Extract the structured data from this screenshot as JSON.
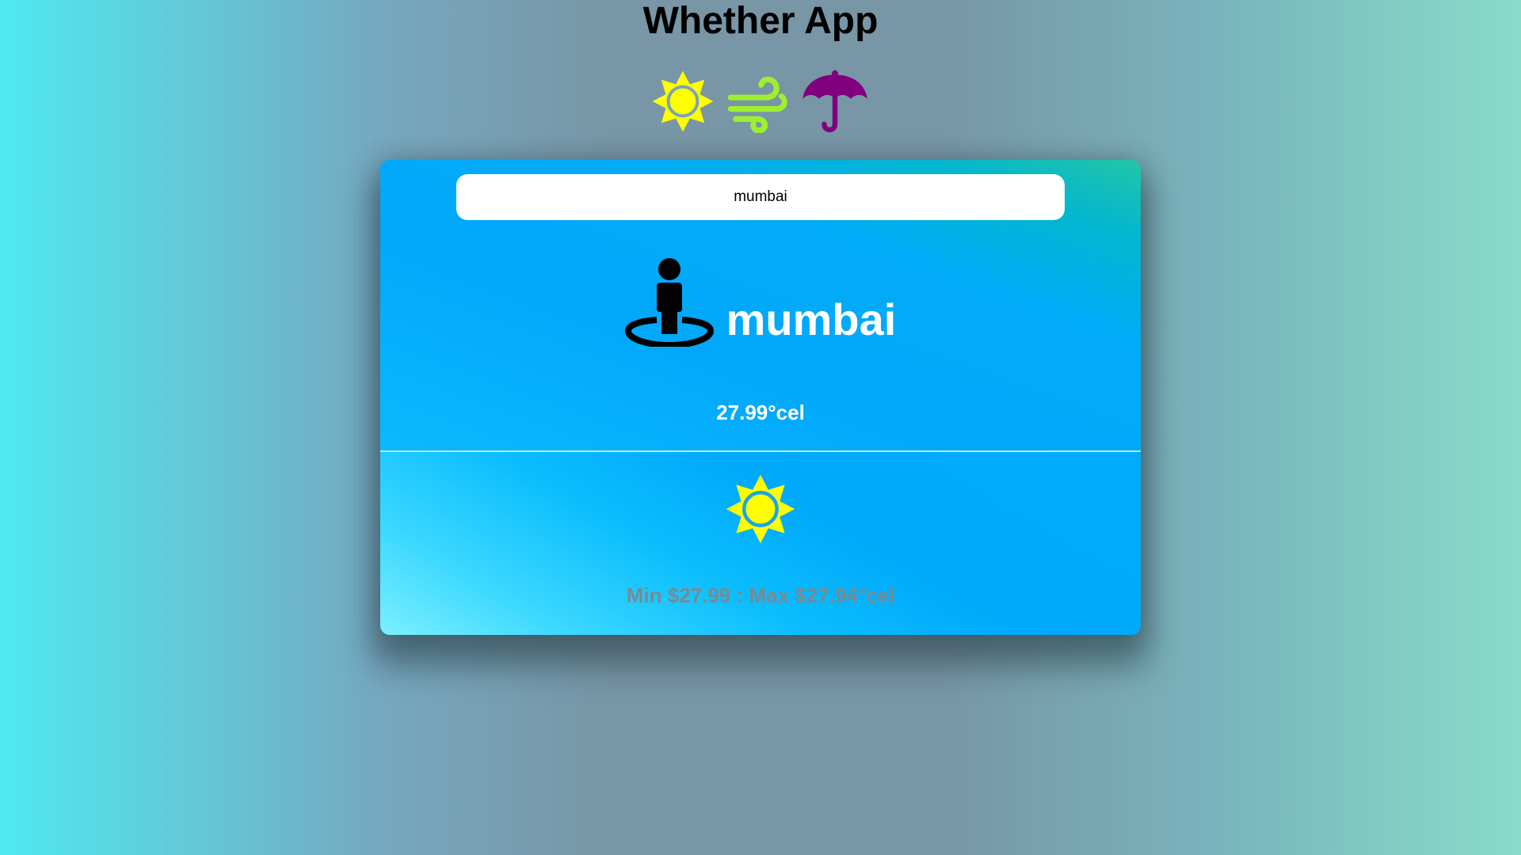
{
  "header": {
    "title": "Whether App",
    "icons": [
      "sun-icon",
      "wind-icon",
      "umbrella-icon"
    ]
  },
  "search": {
    "value": "mumbai",
    "placeholder": ""
  },
  "location": {
    "icon": "street-view-icon",
    "city": "mumbai"
  },
  "weather": {
    "temperature": "27.99°cel",
    "condition_icon": "sun-icon",
    "min_max": "Min $27.99 : Max $27.94°cel"
  },
  "colors": {
    "sun": "#ffff00",
    "wind": "#9ef02f",
    "umbrella": "#800080",
    "card_blue": "#02a8fb",
    "minmax_text": "#7b8990"
  }
}
